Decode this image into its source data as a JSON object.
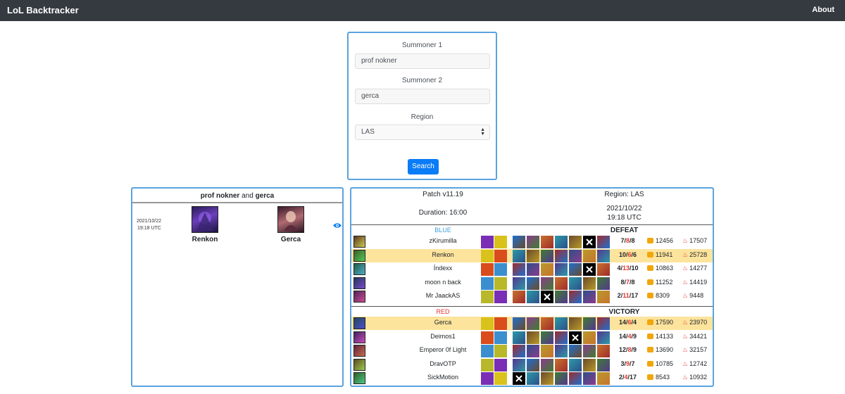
{
  "nav": {
    "brand": "LoL Backtracker",
    "about": "About"
  },
  "search": {
    "summoner1_label": "Summoner 1",
    "summoner1_value": "prof nokner",
    "summoner2_label": "Summoner 2",
    "summoner2_value": "gerca",
    "region_label": "Region",
    "region_value": "LAS",
    "button": "Search"
  },
  "matches": {
    "player1": "prof nokner",
    "connector": "and",
    "player2": "gerca",
    "match": {
      "date": "2021/10/22",
      "time": "19:18 UTC",
      "champ1": "Renkon",
      "champ2": "Gerca"
    }
  },
  "detail": {
    "patch": "Patch v11.19",
    "region": "Region: LAS",
    "duration": "Duration: 16:00",
    "date": "2021/10/22",
    "time": "19:18 UTC",
    "blue": {
      "name": "BLUE",
      "color": "#3aa0d8",
      "result": "DEFEAT",
      "players": [
        {
          "name": "zKirumilla",
          "k": "7",
          "d": "8",
          "a": "8",
          "gold": "12456",
          "dmg": "17507",
          "highlight": false
        },
        {
          "name": "Renkon",
          "k": "10",
          "d": "6",
          "a": "6",
          "gold": "11941",
          "dmg": "25728",
          "highlight": true
        },
        {
          "name": "Índexx",
          "k": "4",
          "d": "13",
          "a": "10",
          "gold": "10863",
          "dmg": "14277",
          "highlight": false
        },
        {
          "name": "moon n back",
          "k": "8",
          "d": "7",
          "a": "8",
          "gold": "11252",
          "dmg": "14419",
          "highlight": false
        },
        {
          "name": "Mr JaackAS",
          "k": "2",
          "d": "11",
          "a": "17",
          "gold": "8309",
          "dmg": "9448",
          "highlight": false
        }
      ]
    },
    "red": {
      "name": "RED",
      "color": "#e3342f",
      "result": "VICTORY",
      "players": [
        {
          "name": "Gerca",
          "k": "14",
          "d": "6",
          "a": "4",
          "gold": "17590",
          "dmg": "23970",
          "highlight": true
        },
        {
          "name": "Deimos1",
          "k": "14",
          "d": "4",
          "a": "9",
          "gold": "14133",
          "dmg": "34421",
          "highlight": false
        },
        {
          "name": "Emperor 0f Light",
          "k": "12",
          "d": "8",
          "a": "9",
          "gold": "13690",
          "dmg": "32157",
          "highlight": false
        },
        {
          "name": "DravOTP",
          "k": "3",
          "d": "9",
          "a": "7",
          "gold": "10785",
          "dmg": "12742",
          "highlight": false
        },
        {
          "name": "SickMotion",
          "k": "2",
          "d": "4",
          "a": "17",
          "gold": "8543",
          "dmg": "10932",
          "highlight": false
        }
      ]
    }
  }
}
